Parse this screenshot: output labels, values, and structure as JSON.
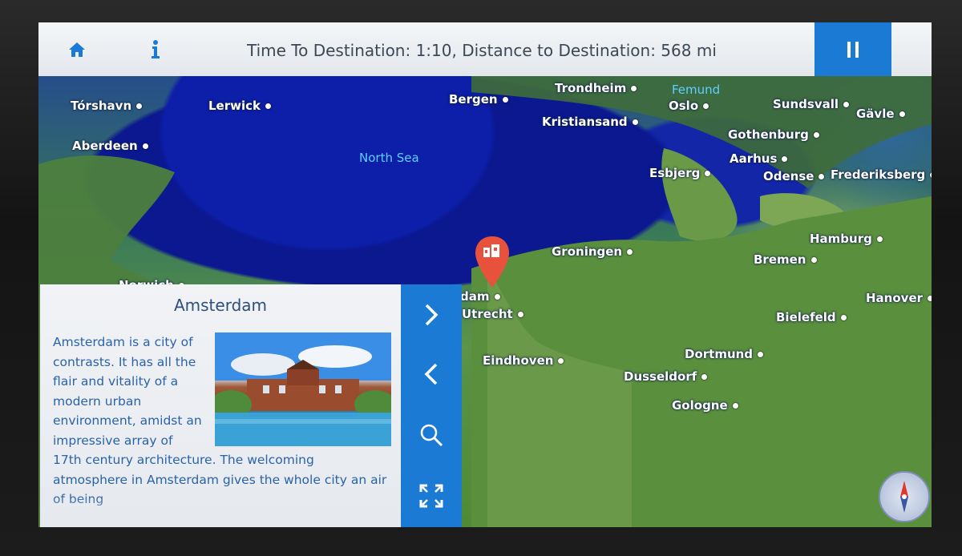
{
  "header": {
    "title": "Time To Destination: 1:10, Distance to Destination: 568 mi",
    "home_icon": "home-icon",
    "info_icon": "info-icon",
    "pause_icon": "pause-icon"
  },
  "map": {
    "sea_labels": [
      "North Sea"
    ],
    "lake_labels": [
      "Femund"
    ],
    "cities": [
      "Tórshavn",
      "Lerwick",
      "Bergen",
      "Trondheim",
      "Oslo",
      "Sundsvall",
      "Gävle",
      "Kristiansand",
      "Gothenburg",
      "Aberdeen",
      "Aarhus",
      "Esbjerg",
      "Odense",
      "Frederiksberg",
      "Hamburg",
      "Bremen",
      "Groningen",
      "Norwich",
      "dam",
      "Utrecht",
      "Hanover",
      "Bielefeld",
      "Eindhoven",
      "Dortmund",
      "Dusseldorf",
      "Gologne"
    ],
    "marker_icon": "city-pin-icon",
    "compass_icon": "compass-icon"
  },
  "info_panel": {
    "title": "Amsterdam",
    "text": "Amsterdam is a city of contrasts. It has all the flair and vitality of a modern urban environment, amidst an impressive array of 17th century architecture. The welcoming atmosphere in Amsterdam gives the whole city an air of being",
    "image_icon": "rijksmuseum-photo"
  },
  "side_controls": {
    "next_icon": "chevron-right-icon",
    "prev_icon": "chevron-left-icon",
    "zoom_icon": "magnifier-icon",
    "fullscreen_icon": "expand-icon"
  },
  "colors": {
    "accent": "#1b7ad3",
    "title_text": "#3c4757",
    "panel_text": "#2a63a8"
  }
}
